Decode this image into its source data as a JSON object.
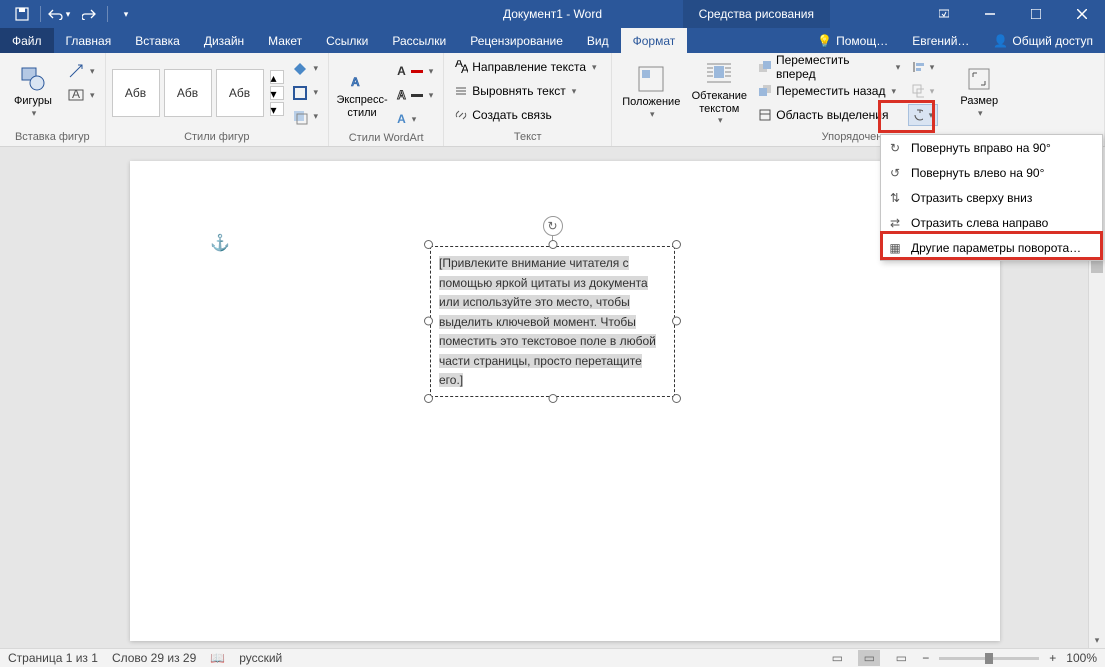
{
  "titlebar": {
    "title": "Документ1 - Word",
    "ctx": "Средства рисования"
  },
  "tabs": {
    "file": "Файл",
    "home": "Главная",
    "insert": "Вставка",
    "design": "Дизайн",
    "layout": "Макет",
    "refs": "Ссылки",
    "mailings": "Рассылки",
    "review": "Рецензирование",
    "view": "Вид",
    "format": "Формат",
    "tell": "Помощ…",
    "user": "Евгений…",
    "share": "Общий доступ"
  },
  "groups": {
    "insertShapes": {
      "label": "Вставка фигур",
      "btn": "Фигуры"
    },
    "shapeStyles": {
      "label": "Стили фигур",
      "item": "Абв"
    },
    "wordart": {
      "label": "Стили WordArt",
      "btn": "Экспресс-\nстили"
    },
    "text": {
      "label": "Текст",
      "dir": "Направление текста",
      "align": "Выровнять текст",
      "link": "Создать связь"
    },
    "arrange": {
      "label": "Упорядочение",
      "pos": "Положение",
      "wrap": "Обтекание\nтекстом",
      "fwd": "Переместить вперед",
      "back": "Переместить назад",
      "pane": "Область выделения",
      "size": "Размер"
    }
  },
  "rotateMenu": {
    "right90": "Повернуть вправо на 90°",
    "left90": "Повернуть влево на 90°",
    "flipV": "Отразить сверху вниз",
    "flipH": "Отразить слева направо",
    "more": "Другие параметры поворота…"
  },
  "textbox": {
    "content": "[Привлеките внимание читателя с помощью яркой цитаты из документа или используйте это место, чтобы выделить ключевой момент. Чтобы поместить это текстовое поле в любой части страницы, просто перетащите его.]"
  },
  "status": {
    "page": "Страница 1 из 1",
    "words": "Слово 29 из 29",
    "lang": "русский",
    "zoom": "100%"
  }
}
